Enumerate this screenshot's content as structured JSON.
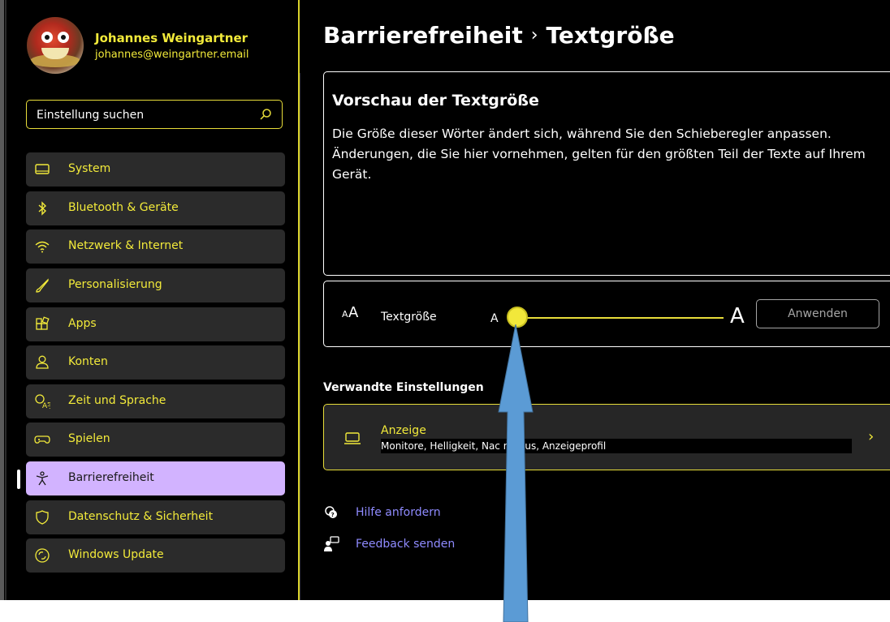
{
  "profile": {
    "name": "Johannes Weingartner",
    "email": "johannes@weingartner.email"
  },
  "search": {
    "placeholder": "Einstellung suchen",
    "icon": "search-icon"
  },
  "sidebar": {
    "items": [
      {
        "label": "System",
        "icon": "monitor-icon"
      },
      {
        "label": "Bluetooth & Geräte",
        "icon": "bluetooth-icon"
      },
      {
        "label": "Netzwerk & Internet",
        "icon": "wifi-icon"
      },
      {
        "label": "Personalisierung",
        "icon": "brush-icon"
      },
      {
        "label": "Apps",
        "icon": "apps-icon"
      },
      {
        "label": "Konten",
        "icon": "person-icon"
      },
      {
        "label": "Zeit und Sprache",
        "icon": "time-language-icon"
      },
      {
        "label": "Spielen",
        "icon": "gamepad-icon"
      },
      {
        "label": "Barrierefreiheit",
        "icon": "accessibility-icon",
        "selected": true
      },
      {
        "label": "Datenschutz & Sicherheit",
        "icon": "shield-icon"
      },
      {
        "label": "Windows Update",
        "icon": "update-icon"
      }
    ]
  },
  "header": {
    "breadcrumb_parent": "Barrierefreiheit",
    "separator": "›",
    "breadcrumb_current": "Textgröße"
  },
  "preview": {
    "heading": "Vorschau der Textgröße",
    "body": "Die Größe dieser Wörter ändert sich, während Sie den Schieberegler anpassen. Änderungen, die Sie hier vornehmen, gelten für den größten Teil der Texte auf Ihrem Gerät."
  },
  "text_size": {
    "label": "Textgröße",
    "small_marker": "A",
    "large_marker": "A",
    "slider_value_fraction": 0.0,
    "apply_label": "Anwenden"
  },
  "related": {
    "heading": "Verwandte Einstellungen",
    "display_title": "Anzeige",
    "display_subtitle": "Monitore, Helligkeit, Nac      modus, Anzeigeprofil"
  },
  "links": {
    "help": "Hilfe anfordern",
    "feedback": "Feedback senden"
  },
  "colors": {
    "accent_yellow": "#f2ea3a",
    "selected_bg": "#d2b3ff",
    "link_blue": "#8f8bff",
    "annotation_arrow": "#5b9bd5"
  }
}
